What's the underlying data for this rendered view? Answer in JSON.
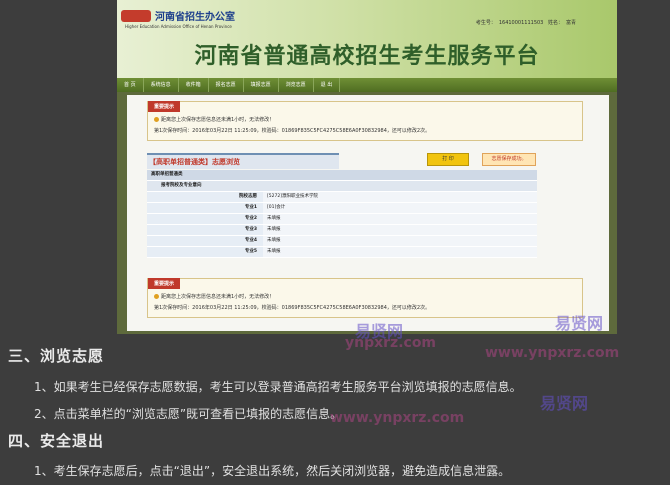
{
  "site": {
    "office_cn": "河南省招生办公室",
    "office_en": "Higher Education Admission Office of Henan Province",
    "user_label_candidate": "考生号：",
    "candidate_no": "16410001111503",
    "user_label_name": "姓名：",
    "name": "富青",
    "platform_title": "河南省普通高校招生考生服务平台"
  },
  "menu": [
    "首 页",
    "系统信息",
    "收件箱",
    "报名志愿",
    "填报志愿",
    "浏览志愿",
    "退 出"
  ],
  "notice_top": {
    "tab": "重要提示",
    "line1": "距离您上次保存志愿信息还未满1小时，无法修改！",
    "line2": "第1次保存时间：2016年03月22日 11:25:09，校验码：01869F835C5FC4275C58E6A0F30832984，还可以修改2次。"
  },
  "panel": {
    "title": "【高职单招普通类】志愿浏览",
    "print_label": "打 印",
    "save_status": "志愿保存成功。",
    "batch": "高职单招普通类",
    "school_major_header": "报考院校及专业意向",
    "rows": [
      {
        "k": "院校志愿",
        "v": "[5272]濮阳职业技术学院"
      },
      {
        "k": "专业1",
        "v": "[01]会计"
      },
      {
        "k": "专业2",
        "v": "未填报"
      },
      {
        "k": "专业3",
        "v": "未填报"
      },
      {
        "k": "专业4",
        "v": "未填报"
      },
      {
        "k": "专业5",
        "v": "未填报"
      }
    ]
  },
  "notice_bottom": {
    "tab": "重要提示",
    "line1": "距离您上次保存志愿信息还未满1小时，无法修改！",
    "line2": "第1次保存时间：2016年03月22日 11:25:09，校验码：01869F835C5FC4275C58E6A0F30832984，还可以修改2次。"
  },
  "article": {
    "section3": "三、浏览志愿",
    "p1": "1、如果考生已经保存志愿数据，考生可以登录普通高招考生服务平台浏览填报的志愿信息。",
    "p2": "2、点击菜单栏的“浏览志愿”既可查看已填报的志愿信息。",
    "section4": "四、安全退出",
    "p3": "1、考生保存志愿后，点击“退出”，安全退出系统，然后关闭浏览器，避免造成信息泄露。"
  },
  "watermarks": [
    "易贤网",
    "ynpxrz.com",
    "www.ynpxrz.com",
    "易贤网",
    "www.ynpxrz.com",
    "易贤网"
  ]
}
